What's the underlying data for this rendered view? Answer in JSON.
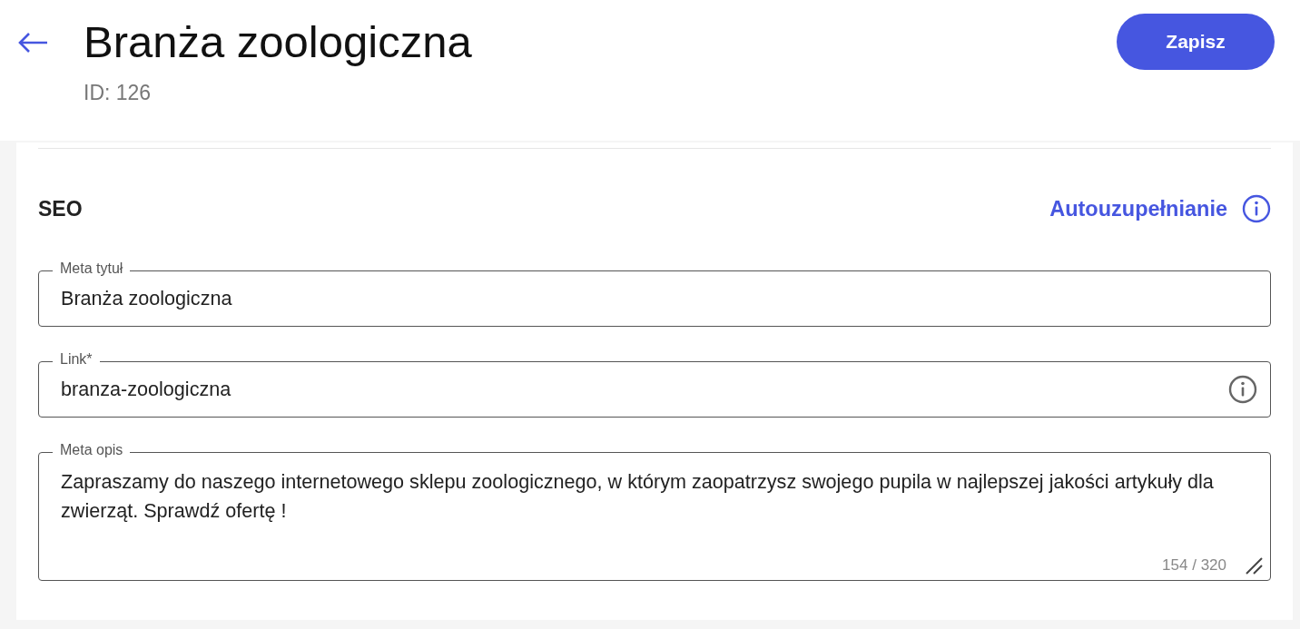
{
  "header": {
    "title": "Branża zoologiczna",
    "id_label": "ID: 126",
    "save_button": "Zapisz"
  },
  "seo": {
    "title": "SEO",
    "autofill_link": "Autouzupełnianie",
    "fields": [
      {
        "kind": "input",
        "label": "Meta tytuł",
        "value": "Branża zoologiczna",
        "info": false
      },
      {
        "kind": "input",
        "label": "Link*",
        "value": "branza-zoologiczna",
        "info": true
      },
      {
        "kind": "textarea",
        "label": "Meta opis",
        "value": "Zapraszamy do naszego internetowego sklepu zoologicznego, w którym zaopatrzysz swojego pupila w najlepszej jakości artykuły dla zwierząt. Sprawdź ofertę !",
        "counter": "154 / 320",
        "info": false
      }
    ]
  }
}
